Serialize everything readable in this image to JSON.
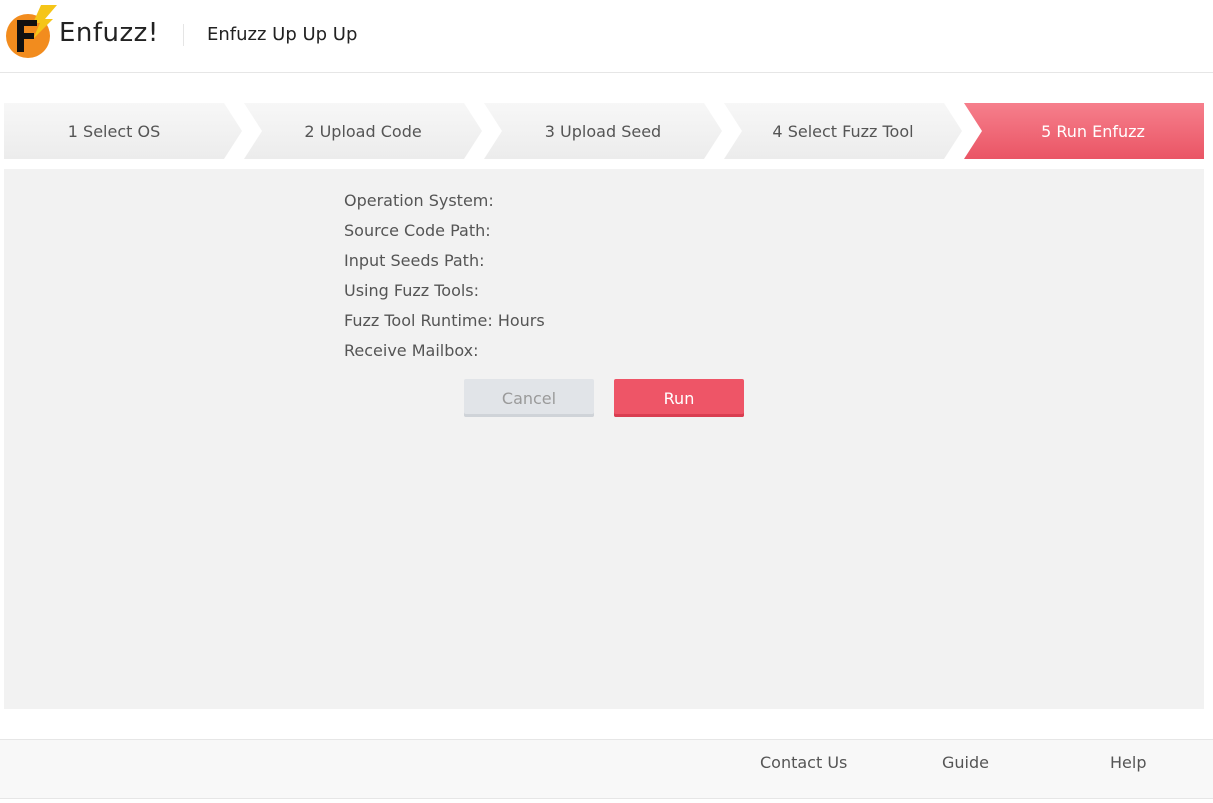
{
  "header": {
    "brand": "Enfuzz!",
    "subtitle": "Enfuzz Up Up Up",
    "logo_letter": "F"
  },
  "steps": [
    {
      "label": "1 Select OS",
      "active": false
    },
    {
      "label": "2 Upload Code",
      "active": false
    },
    {
      "label": "3 Upload Seed",
      "active": false
    },
    {
      "label": "4 Select Fuzz Tool",
      "active": false
    },
    {
      "label": "5 Run Enfuzz",
      "active": true
    }
  ],
  "summary": {
    "os_label": "Operation System:",
    "os_value": "",
    "source_label": "Source Code Path:",
    "source_value": "",
    "seeds_label": "Input Seeds Path:",
    "seeds_value": "",
    "tools_label": "Using Fuzz Tools:",
    "tools_value": "",
    "runtime_label": "Fuzz Tool Runtime:",
    "runtime_unit": "Hours",
    "mailbox_label": "Receive Mailbox:",
    "mailbox_value": ""
  },
  "actions": {
    "cancel_label": "Cancel",
    "run_label": "Run"
  },
  "footer": {
    "contact": "Contact Us",
    "guide": "Guide",
    "help": "Help"
  },
  "colors": {
    "accent": "#ee5567",
    "logo_orange": "#f28c1e",
    "logo_bolt": "#f5c518",
    "panel_bg": "#f2f2f2"
  }
}
